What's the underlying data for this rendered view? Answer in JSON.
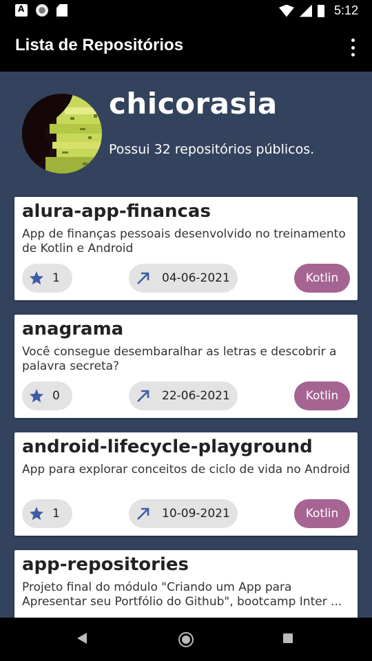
{
  "status_bar": {
    "time": "5:12",
    "icons": [
      "accessibility-icon",
      "sync-icon",
      "sd-card-icon",
      "wifi-icon",
      "signal-icon",
      "battery-icon"
    ]
  },
  "app_bar": {
    "title": "Lista de Repositórios",
    "menu_icon": "more-vert-icon"
  },
  "profile": {
    "username": "chicorasia",
    "repo_count": "Possui 32 repositórios públicos."
  },
  "repos": [
    {
      "name": "alura-app-financas",
      "description": "App de finanças pessoais desenvolvido no treinamento de Kotlin e Android",
      "stars": "1",
      "date": "04-06-2021",
      "language": "Kotlin"
    },
    {
      "name": "anagrama",
      "description": "Você consegue desembaralhar as letras e descobrir a palavra secreta?",
      "stars": "0",
      "date": "22-06-2021",
      "language": "Kotlin"
    },
    {
      "name": "android-lifecycle-playground",
      "description": "App para explorar conceitos de ciclo de vida no Android",
      "stars": "1",
      "date": "10-09-2021",
      "language": "Kotlin"
    },
    {
      "name": "app-repositories",
      "description": "Projeto final do módulo \"Criando um App para Apresentar seu Portfólio do Github\", bootcamp Inter ...",
      "stars": "",
      "date": "",
      "language": ""
    }
  ],
  "colors": {
    "background": "#33435e",
    "star": "#3d5ea6",
    "language_chip": "#a66493",
    "chip": "#e3e3e3"
  },
  "nav_bar": {
    "icons": [
      "back-icon",
      "home-icon",
      "recents-icon"
    ]
  }
}
